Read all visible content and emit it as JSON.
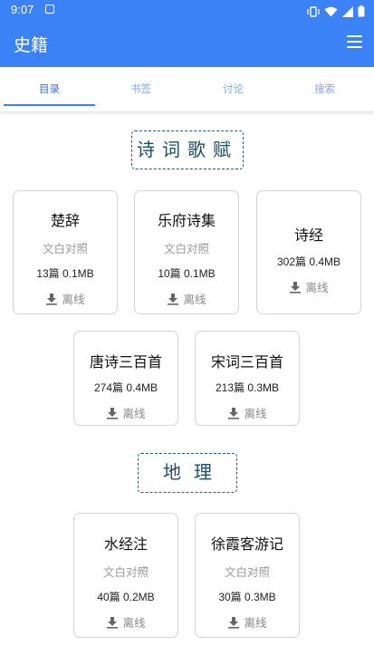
{
  "status": {
    "time": "9:07"
  },
  "app": {
    "title": "史籍"
  },
  "tabs": [
    {
      "label": "目录",
      "active": true
    },
    {
      "label": "书签",
      "active": false
    },
    {
      "label": "讨论",
      "active": false
    },
    {
      "label": "搜索",
      "active": false
    }
  ],
  "sections": [
    {
      "title": "诗词歌赋",
      "books": [
        {
          "name": "楚辞",
          "sub": "文白对照",
          "meta": "13篇 0.1MB",
          "action": "离线"
        },
        {
          "name": "乐府诗集",
          "sub": "文白对照",
          "meta": "10篇 0.1MB",
          "action": "离线"
        },
        {
          "name": "诗经",
          "meta": "302篇 0.4MB",
          "action": "离线"
        },
        {
          "name": "唐诗三百首",
          "meta": "274篇 0.4MB",
          "action": "离线"
        },
        {
          "name": "宋词三百首",
          "meta": "213篇 0.3MB",
          "action": "离线"
        }
      ]
    },
    {
      "title": "地理",
      "books": [
        {
          "name": "水经注",
          "sub": "文白对照",
          "meta": "40篇 0.2MB",
          "action": "离线"
        },
        {
          "name": "徐霞客游记",
          "sub": "文白对照",
          "meta": "30篇 0.3MB",
          "action": "离线"
        }
      ]
    }
  ],
  "colors": {
    "primary": "#3a82f6",
    "tab_active": "#2e6fe0",
    "tab_inactive": "#7fa8e8",
    "section_border": "#2a5a6e"
  }
}
